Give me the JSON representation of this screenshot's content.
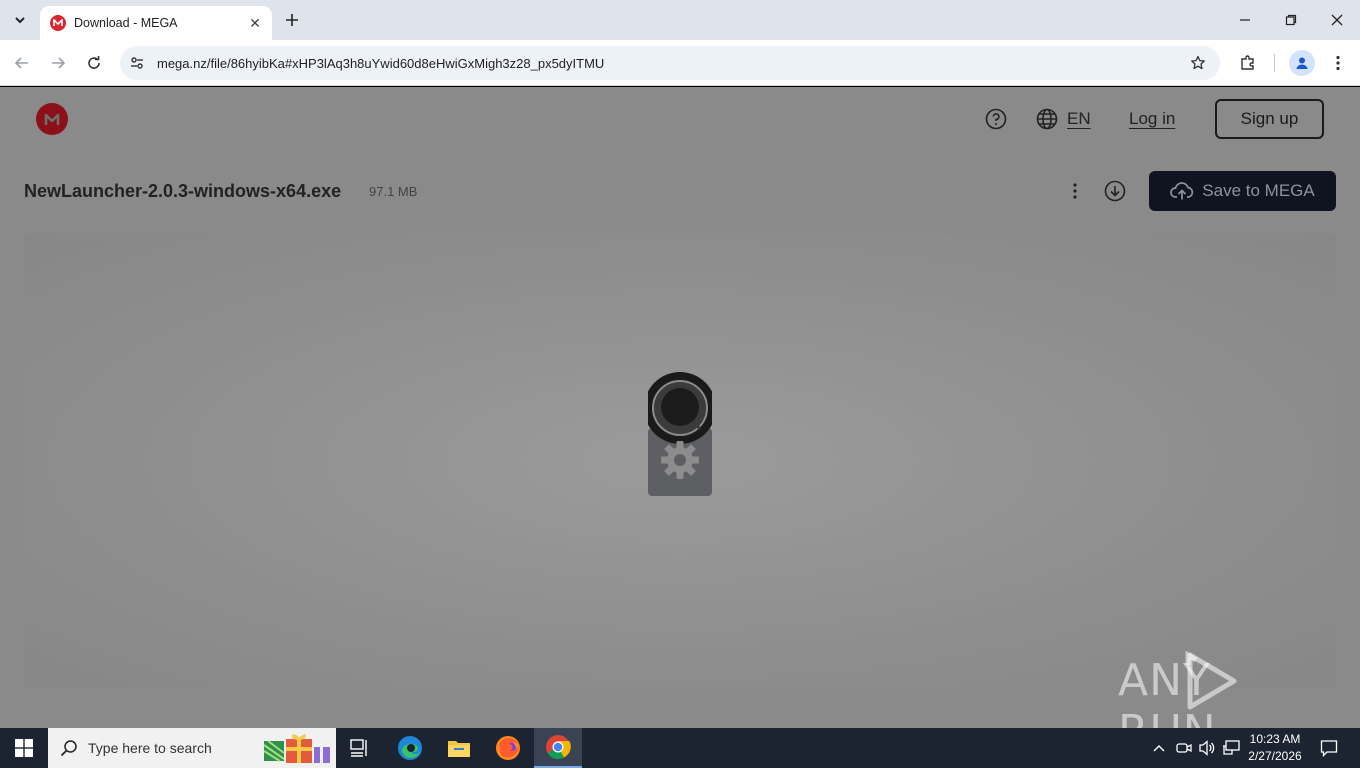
{
  "browser": {
    "tab": {
      "title": "Download - MEGA",
      "close": "✕"
    },
    "url": "mega.nz/file/86hyibKa#xHP3lAq3h8uYwid60d8eHwiGxMigh3z28_px5dyITMU"
  },
  "page": {
    "header": {
      "lang": "EN",
      "login": "Log in",
      "signup": "Sign up"
    },
    "file": {
      "name": "NewLauncher-2.0.3-windows-x64.exe",
      "size": "97.1 MB"
    },
    "save_button": "Save to MEGA",
    "watermark": "ANY RUN"
  },
  "taskbar": {
    "search_placeholder": "Type here to search",
    "clock": {
      "time": "10:23 AM",
      "date": "2/27/2026"
    }
  },
  "colors": {
    "mega_red": "#d9272e",
    "taskbar": "#1c2431",
    "save_button_bg": "#0f1420"
  }
}
